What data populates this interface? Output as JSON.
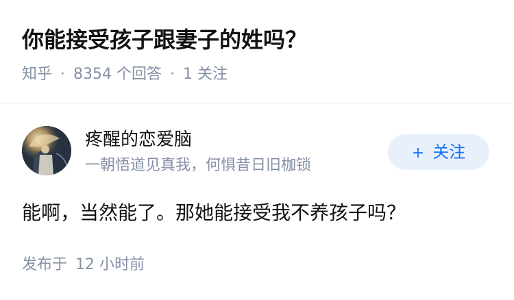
{
  "question": {
    "title": "你能接受孩子跟妻子的姓吗？",
    "source": "知乎",
    "separator": "·",
    "answer_count": "8354",
    "answer_label": "个回答",
    "follower_count": "1",
    "follower_label": "关注"
  },
  "answer": {
    "author": {
      "name": "疼醒的恋爱脑",
      "bio": "一朝悟道见真我，何惧昔日旧枷锁",
      "avatar_icon": "avatar-image"
    },
    "follow_button": {
      "icon": "plus-icon",
      "icon_glyph": "+",
      "label": "关注"
    },
    "content": "能啊，当然能了。那她能接受我不养孩子吗？",
    "published_label": "发布于",
    "published_time": "12 小时前"
  },
  "colors": {
    "text_primary": "#121212",
    "text_secondary": "#8590a6",
    "brand_blue": "#1772f6",
    "button_bg": "#e8f1fb",
    "divider": "#ebebeb"
  }
}
